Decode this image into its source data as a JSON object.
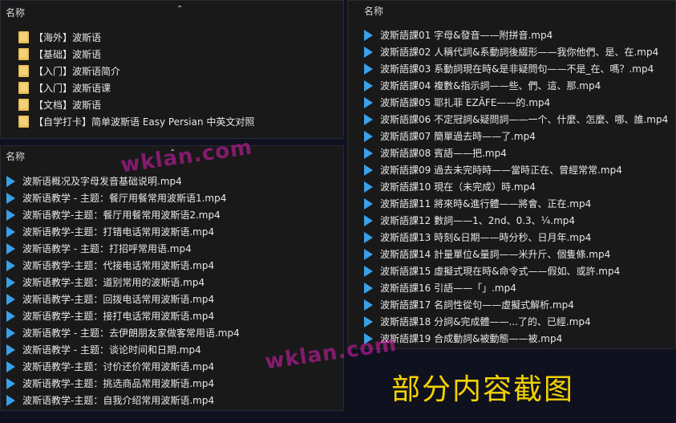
{
  "folders_pane": {
    "header": "名称",
    "items": [
      "【海外】波斯语",
      "【基础】波斯语",
      "【入门】波斯语简介",
      "【入门】波斯语课",
      "【文档】波斯语",
      "【自学打卡】简单波斯语 Easy Persian 中英文对照"
    ]
  },
  "left_pane": {
    "header": "名称",
    "items": [
      "波斯语概况及字母发音基础说明.mp4",
      "波斯语教学 - 主题：餐厅用餐常用波斯语1.mp4",
      "波斯语教学-主题：餐厅用餐常用波斯语2.mp4",
      "波斯语教学-主题：打错电话常用波斯语.mp4",
      "波斯语教学 - 主题：打招呼常用语.mp4",
      "波斯语教学-主题：代接电话常用波斯语.mp4",
      "波斯语教学-主题：道别常用的波斯语.mp4",
      "波斯语教学-主题：回拨电话常用波斯语.mp4",
      "波斯语教学-主题：接打电话常用波斯语.mp4",
      "波斯语教学 - 主题：去伊朗朋友家做客常用语.mp4",
      "波斯语教学 - 主题：谈论时间和日期.mp4",
      "波斯语教学-主题：讨价还价常用波斯语.mp4",
      "波斯语教学-主题：挑选商品常用波斯语.mp4",
      "波斯语教学-主题：自我介绍常用波斯语.mp4"
    ]
  },
  "right_pane": {
    "header": "名称",
    "items": [
      "波斯語課01 字母&發音——附拼音.mp4",
      "波斯語課02 人稱代詞&系動詞後綴形——我你他們、是、在.mp4",
      "波斯語課03 系動詞現在時&是非疑問句——不是_在、嗎？.mp4",
      "波斯語課04 複數&指示詞——些、們、這、那.mp4",
      "波斯語課05 耶扎菲 EZĀFE——的.mp4",
      "波斯語課06 不定冠詞&疑問詞——一个、什麼、怎麼、哪、誰.mp4",
      "波斯語課07 簡單過去時——了.mp4",
      "波斯語課08 賓語——把.mp4",
      "波斯語課09 過去未完時時——當時正在、曾經常常.mp4",
      "波斯語課10 現在（未完成）時.mp4",
      "波斯語課11 將來時&進行體——將會、正在.mp4",
      "波斯語課12 數詞——1、2nd、0.3、¼.mp4",
      "波斯語課13 時刻&日期——時分秒、日月年.mp4",
      "波斯語課14 計量單位&量詞——米升斤、個隻條.mp4",
      "波斯語課15 虛擬式現在時&命令式——假如、或許.mp4",
      "波斯語課16 引語——「」.mp4",
      "波斯語課17 名詞性從句——虛擬式解析.mp4",
      "波斯語課18 分詞&完成體——...了的、已經.mp4",
      "波斯語課19 合成動詞&被動態——被.mp4"
    ]
  },
  "watermark": "wklan.com",
  "caption": "部分内容截图",
  "icons": {
    "folder": "folder-icon",
    "video": "video-file-icon",
    "sort": "sort-caret-icon"
  },
  "colors": {
    "pane_bg": "#191919",
    "page_bg": "#10111e",
    "folder": "#e9c05b",
    "video": "#3aa0e8",
    "watermark": "#dc1eb4",
    "caption": "#f4d200"
  }
}
